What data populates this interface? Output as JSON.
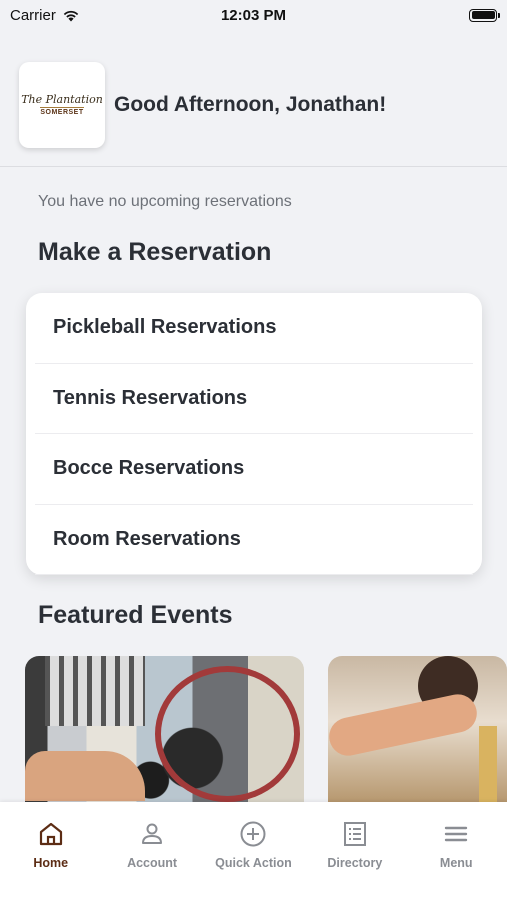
{
  "status_bar": {
    "carrier": "Carrier",
    "time": "12:03 PM",
    "battery_level": 1.0
  },
  "header": {
    "logo": {
      "script": "The Plantation",
      "sub": "SOMERSET"
    },
    "greeting": "Good Afternoon, Jonathan!"
  },
  "reservations": {
    "empty_message": "You have no upcoming reservations",
    "title": "Make a Reservation",
    "items": [
      {
        "label": "Pickleball Reservations"
      },
      {
        "label": "Tennis Reservations"
      },
      {
        "label": "Bocce Reservations"
      },
      {
        "label": "Room Reservations"
      }
    ]
  },
  "events": {
    "title": "Featured Events"
  },
  "tab_bar": {
    "items": [
      {
        "label": "Home",
        "icon": "home-icon",
        "active": true
      },
      {
        "label": "Account",
        "icon": "person-icon",
        "active": false
      },
      {
        "label": "Quick Action",
        "icon": "plus-circle-icon",
        "active": false
      },
      {
        "label": "Directory",
        "icon": "list-icon",
        "active": false
      },
      {
        "label": "Menu",
        "icon": "hamburger-icon",
        "active": false
      }
    ],
    "active_color": "#5c2c14",
    "inactive_color": "#8a8d93"
  }
}
